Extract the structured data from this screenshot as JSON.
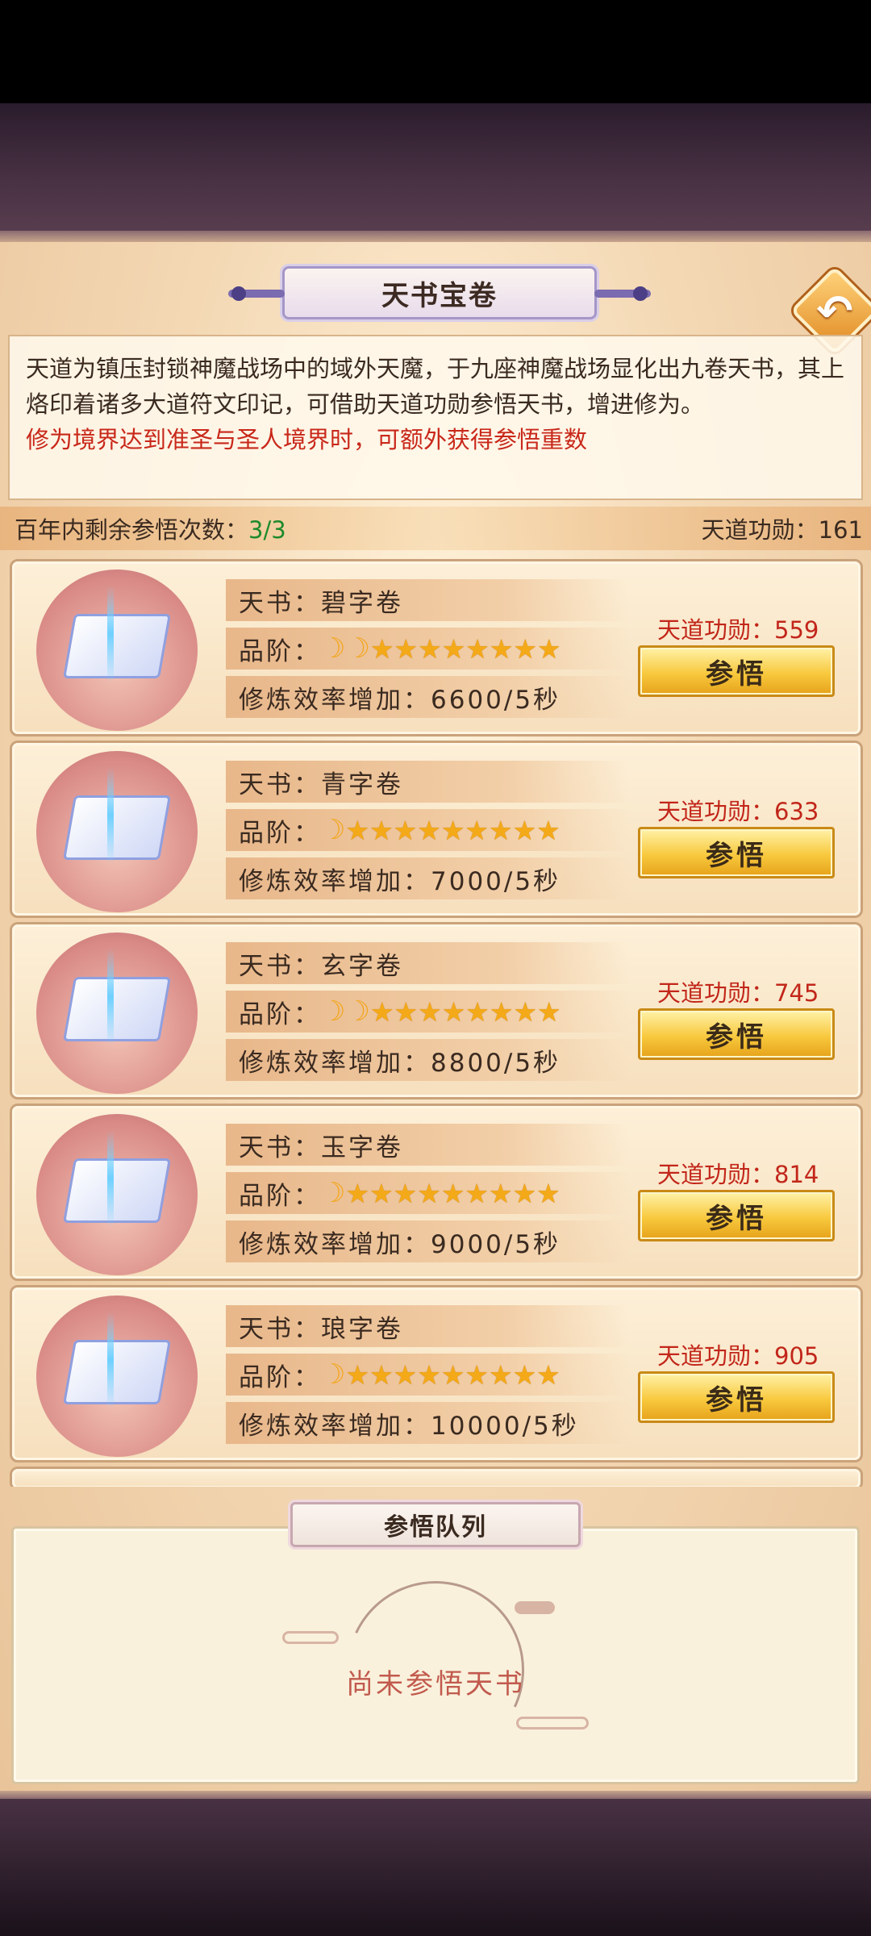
{
  "title": "天书宝卷",
  "description": {
    "text": "天道为镇压封锁神魔战场中的域外天魔，于九座神魔战场显化出九卷天书，其上烙印着诸多大道符文印记，可借助天道功勋参悟天书，增进修为。",
    "highlight": "修为境界达到准圣与圣人境界时，可额外获得参悟重数"
  },
  "stats": {
    "remaining_label": "百年内剩余参悟次数：",
    "remaining_value": "3/3",
    "merit_label": "天道功勋：",
    "merit_value": "161"
  },
  "books": [
    {
      "name": "天书：碧字卷",
      "grade_label": "品阶：",
      "moons": "☽☽",
      "stars": "★★★★★★★★",
      "efficiency": "修炼效率增加：6600/5秒",
      "cost": "天道功勋：559",
      "action": "参悟"
    },
    {
      "name": "天书：青字卷",
      "grade_label": "品阶：",
      "moons": "☽",
      "stars": "★★★★★★★★★",
      "efficiency": "修炼效率增加：7000/5秒",
      "cost": "天道功勋：633",
      "action": "参悟"
    },
    {
      "name": "天书：玄字卷",
      "grade_label": "品阶：",
      "moons": "☽☽",
      "stars": "★★★★★★★★",
      "efficiency": "修炼效率增加：8800/5秒",
      "cost": "天道功勋：745",
      "action": "参悟"
    },
    {
      "name": "天书：玉字卷",
      "grade_label": "品阶：",
      "moons": "☽",
      "stars": "★★★★★★★★★",
      "efficiency": "修炼效率增加：9000/5秒",
      "cost": "天道功勋：814",
      "action": "参悟"
    },
    {
      "name": "天书：琅字卷",
      "grade_label": "品阶：",
      "moons": "☽",
      "stars": "★★★★★★★★★",
      "efficiency": "修炼效率增加：10000/5秒",
      "cost": "天道功勋：905",
      "action": "参悟"
    }
  ],
  "queue": {
    "title": "参悟队列",
    "empty_text": "尚未参悟天书"
  },
  "icons": {
    "back": "back-arrow-icon"
  }
}
